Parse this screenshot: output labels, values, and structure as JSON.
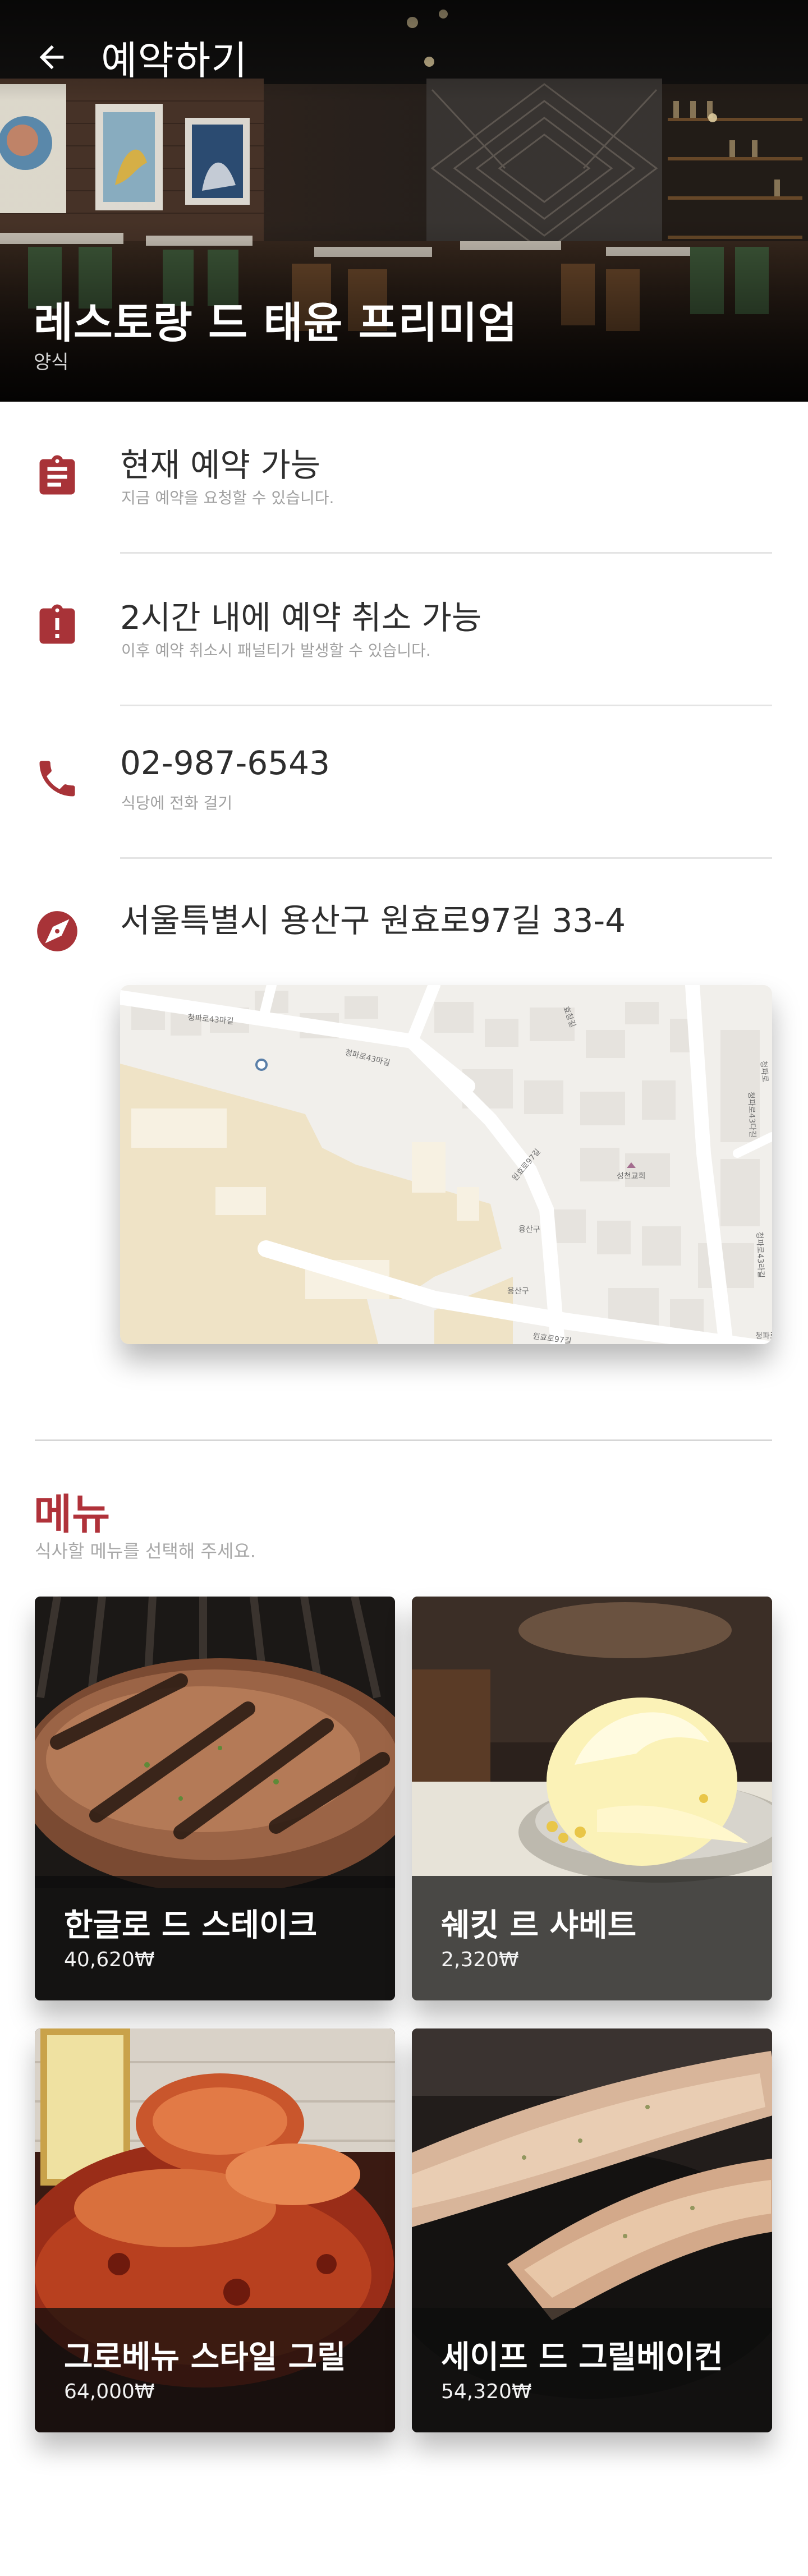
{
  "header": {
    "title": "예약하기",
    "back_icon": "arrow-left-icon"
  },
  "restaurant": {
    "name": "레스토랑 드 태윤 프리미엄",
    "category": "양식"
  },
  "info": {
    "availability": {
      "title": "현재 예약 가능",
      "subtitle": "지금 예약을 요청할 수 있습니다.",
      "icon": "clipboard-list-icon"
    },
    "cancellation": {
      "title": "2시간 내에 예약 취소 가능",
      "subtitle": "이후 예약 취소시 패널티가 발생할 수 있습니다.",
      "icon": "clipboard-alert-icon"
    },
    "phone": {
      "title": "02-987-6543",
      "subtitle": "식당에 전화 걸기",
      "icon": "phone-icon"
    },
    "address": {
      "title": "서울특별시 용산구 원효로97길 33-4",
      "icon": "compass-icon"
    }
  },
  "map": {
    "labels": [
      "청파로43마길",
      "청파로43마길",
      "원효로97길",
      "용산구",
      "청파로43다길",
      "청파로43라길",
      "성천교회",
      "청파로",
      "효창길",
      "원효로97길",
      "용산구",
      "청파로"
    ]
  },
  "menu": {
    "title": "메뉴",
    "subtitle": "식사할 메뉴를 선택해 주세요.",
    "items": [
      {
        "name": "한글로 드 스테이크",
        "price": "40,620₩"
      },
      {
        "name": "쉐킷 르 샤베트",
        "price": "2,320₩"
      },
      {
        "name": "그로베뉴 스타일 그릴",
        "price": "64,000₩"
      },
      {
        "name": "세이프 드 그릴베이컨",
        "price": "54,320₩"
      }
    ]
  },
  "colors": {
    "accent": "#b0323a",
    "icon": "#a83338",
    "divider": "#e4e4e4"
  }
}
